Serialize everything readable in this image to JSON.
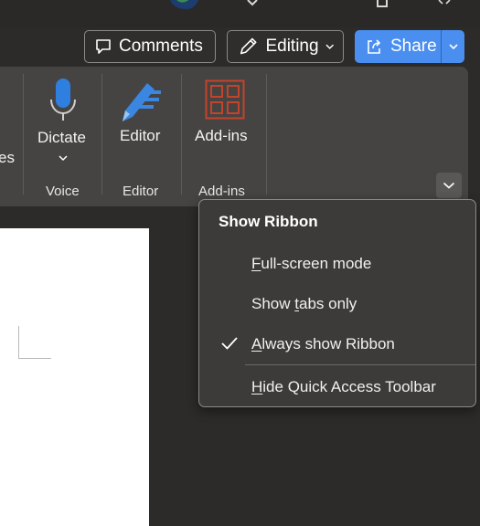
{
  "topbar": {
    "comments_label": "Comments",
    "editing_label": "Editing",
    "share_label": "Share"
  },
  "ribbon": {
    "partial_label": "es",
    "dictate_label": "Dictate",
    "editor_label": "Editor",
    "addins_label": "Add-ins",
    "groups": {
      "voice": "Voice",
      "editor": "Editor",
      "addins": "Add-ins"
    }
  },
  "menu": {
    "header": "Show Ribbon",
    "items": [
      {
        "pre": "",
        "key": "F",
        "post": "ull-screen mode",
        "checked": false
      },
      {
        "pre": "Show ",
        "key": "t",
        "post": "abs only",
        "checked": false
      },
      {
        "pre": "",
        "key": "A",
        "post": "lways show Ribbon",
        "checked": true
      },
      {
        "pre": "",
        "key": "H",
        "post": "ide Quick Access Toolbar",
        "checked": false
      }
    ]
  },
  "colors": {
    "share": "#4a8ff0",
    "dictate_mic": "#2f7fe0",
    "editor_pen": "#3b86e0",
    "addins": "#c4432b",
    "ribbon_bg": "#464442",
    "menu_bg": "#3d3b39"
  },
  "icons": {
    "comments": "comment-icon",
    "editing": "pencil-icon",
    "share": "share-icon",
    "dictate": "microphone-icon",
    "editor": "editor-pen-icon",
    "addins": "addins-grid-icon",
    "collapse": "chevron-down-icon",
    "checked": "checkmark-icon"
  }
}
